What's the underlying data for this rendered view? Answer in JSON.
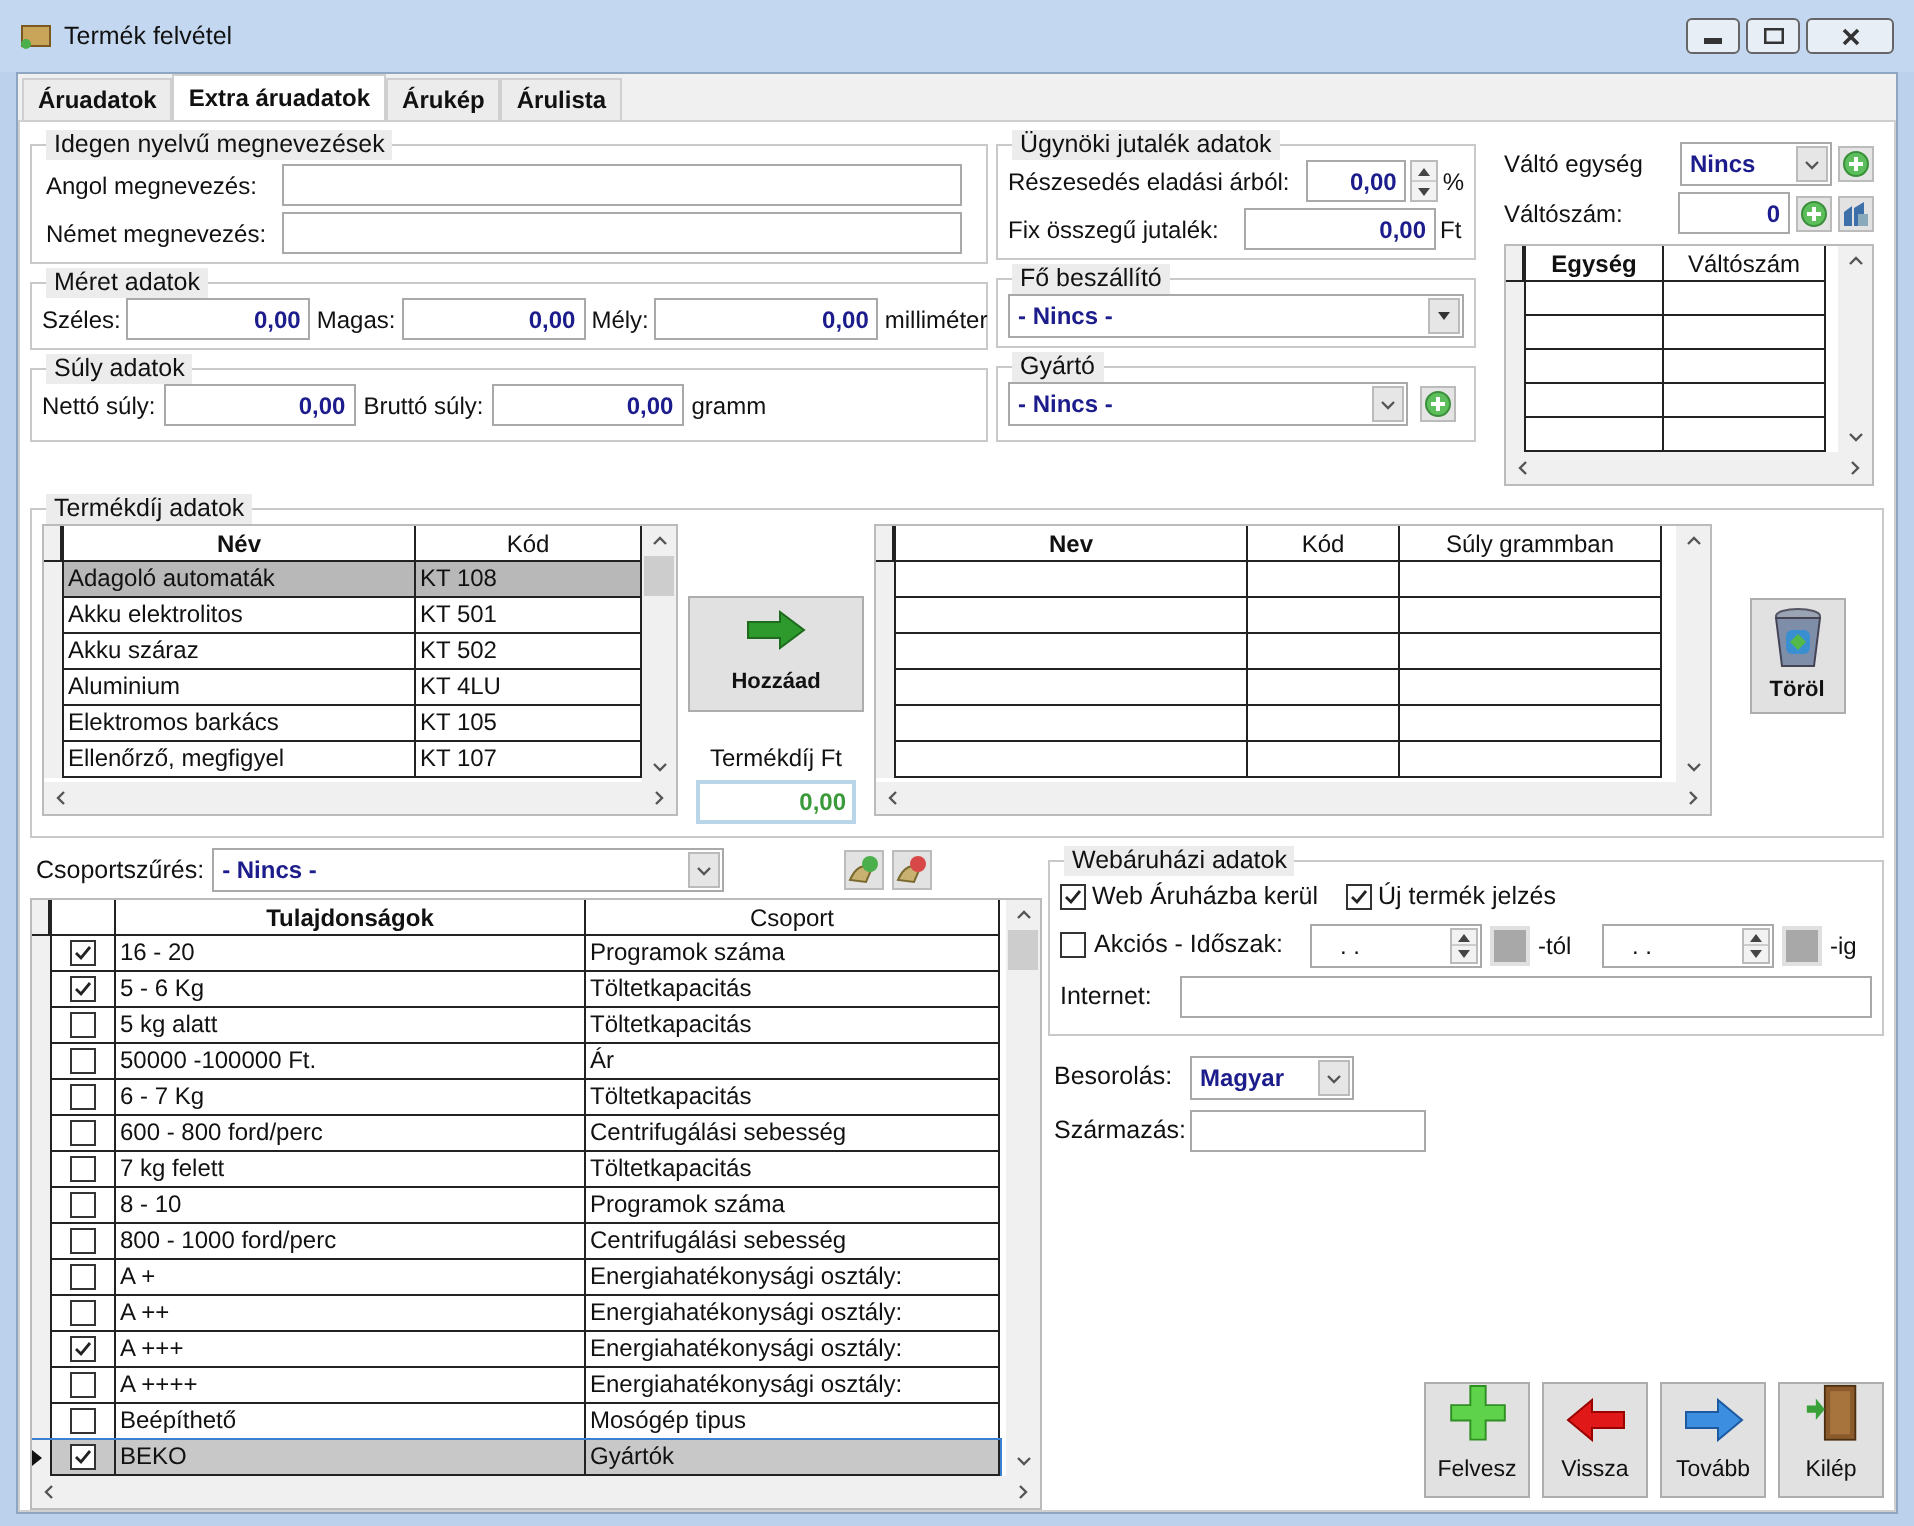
{
  "window": {
    "title": "Termék felvétel"
  },
  "tabs": [
    {
      "label": "Áruadatok",
      "selected": false
    },
    {
      "label": "Extra áruadatok",
      "selected": true
    },
    {
      "label": "Árukép",
      "selected": false
    },
    {
      "label": "Árulista",
      "selected": false
    }
  ],
  "foreign_names": {
    "title": "Idegen nyelvű megnevezések",
    "fields": [
      {
        "label": "Angol megnevezés:"
      },
      {
        "label": "Német megnevezés:"
      }
    ]
  },
  "dimensions": {
    "title": "Méret adatok",
    "fields": [
      {
        "label": "Széles:",
        "value": "0,00"
      },
      {
        "label": "Magas:",
        "value": "0,00"
      },
      {
        "label": "Mély:",
        "value": "0,00"
      }
    ],
    "unit": "milliméter"
  },
  "weight": {
    "title": "Súly adatok",
    "fields": [
      {
        "label": "Nettó súly:",
        "value": "0,00"
      },
      {
        "label": "Bruttó súly:",
        "value": "0,00"
      }
    ],
    "unit": "gramm"
  },
  "agent_commission": {
    "title": "Ügynöki jutalék adatok",
    "share": {
      "label": "Részesedés eladási árból:",
      "value": "0,00",
      "unit": "%"
    },
    "fixed": {
      "label": "Fix összegű jutalék:",
      "value": "0,00",
      "unit": "Ft"
    }
  },
  "main_supplier": {
    "title": "Fő beszállító",
    "value": "- Nincs -"
  },
  "manufacturer": {
    "title": "Gyártó",
    "value": "- Nincs -"
  },
  "conversion": {
    "unit_label": "Váltó egység",
    "unit_value": "Nincs",
    "number_label": "Váltószám:",
    "number_value": "0",
    "columns": [
      "Egység",
      "Váltószám"
    ]
  },
  "product_fee": {
    "title": "Termékdíj adatok",
    "source_columns": [
      "Név",
      "Kód"
    ],
    "source_rows": [
      {
        "name": "Adagoló automaták",
        "code": "KT 108",
        "selected": true
      },
      {
        "name": "Akku elektrolitos",
        "code": "KT 501",
        "selected": false
      },
      {
        "name": "Akku száraz",
        "code": "KT 502",
        "selected": false
      },
      {
        "name": "Aluminium",
        "code": "KT 4LU",
        "selected": false
      },
      {
        "name": "Elektromos barkács",
        "code": "KT 105",
        "selected": false
      },
      {
        "name": "Ellenőrző, megfigyel",
        "code": "KT 107",
        "selected": false
      }
    ],
    "add_button": "Hozzáad",
    "fee_label": "Termékdíj Ft",
    "fee_value": "0,00",
    "target_columns": [
      "Nev",
      "Kód",
      "Súly grammban"
    ],
    "delete_button": "Töröl"
  },
  "group_filter": {
    "label": "Csoportszűrés:",
    "value": "- Nincs -"
  },
  "properties": {
    "columns": [
      "Tulajdonságok",
      "Csoport"
    ],
    "rows": [
      {
        "checked": true,
        "name": "16 - 20",
        "group": "Programok száma",
        "selected": false
      },
      {
        "checked": true,
        "name": "5 - 6 Kg",
        "group": "Töltetkapacitás",
        "selected": false
      },
      {
        "checked": false,
        "name": "5 kg alatt",
        "group": "Töltetkapacitás",
        "selected": false
      },
      {
        "checked": false,
        "name": "50000 -100000 Ft.",
        "group": "Ár",
        "selected": false
      },
      {
        "checked": false,
        "name": "6 - 7 Kg",
        "group": "Töltetkapacitás",
        "selected": false
      },
      {
        "checked": false,
        "name": "600 - 800 ford/perc",
        "group": "Centrifugálási sebesség",
        "selected": false
      },
      {
        "checked": false,
        "name": "7 kg felett",
        "group": "Töltetkapacitás",
        "selected": false
      },
      {
        "checked": false,
        "name": "8 - 10",
        "group": "Programok száma",
        "selected": false
      },
      {
        "checked": false,
        "name": "800 - 1000 ford/perc",
        "group": "Centrifugálási sebesség",
        "selected": false
      },
      {
        "checked": false,
        "name": "A +",
        "group": "Energiahatékonysági osztály:",
        "selected": false
      },
      {
        "checked": false,
        "name": "A ++",
        "group": "Energiahatékonysági osztály:",
        "selected": false
      },
      {
        "checked": true,
        "name": "A +++",
        "group": "Energiahatékonysági osztály:",
        "selected": false
      },
      {
        "checked": false,
        "name": "A ++++",
        "group": "Energiahatékonysági osztály:",
        "selected": false
      },
      {
        "checked": false,
        "name": "Beépíthető",
        "group": "Mosógép tipus",
        "selected": false
      },
      {
        "checked": true,
        "name": "BEKO",
        "group": "Gyártók",
        "selected": true
      }
    ]
  },
  "webshop": {
    "title": "Webáruházi adatok",
    "checks": [
      {
        "label": "Web Áruházba kerül",
        "checked": true
      },
      {
        "label": "Új termék jelzés",
        "checked": true
      }
    ],
    "sale": {
      "label": "Akciós - Időszak:",
      "checked": false,
      "from_value": ". .",
      "from_suffix": "-tól",
      "to_value": ". .",
      "to_suffix": "-ig"
    },
    "internet_label": "Internet:"
  },
  "classification": {
    "label": "Besorolás:",
    "value": "Magyar"
  },
  "origin": {
    "label": "Származás:"
  },
  "buttons": [
    {
      "label": "Felvesz",
      "kind": "add"
    },
    {
      "label": "Vissza",
      "kind": "back"
    },
    {
      "label": "Tovább",
      "kind": "forward"
    },
    {
      "label": "Kilép",
      "kind": "exit"
    }
  ]
}
